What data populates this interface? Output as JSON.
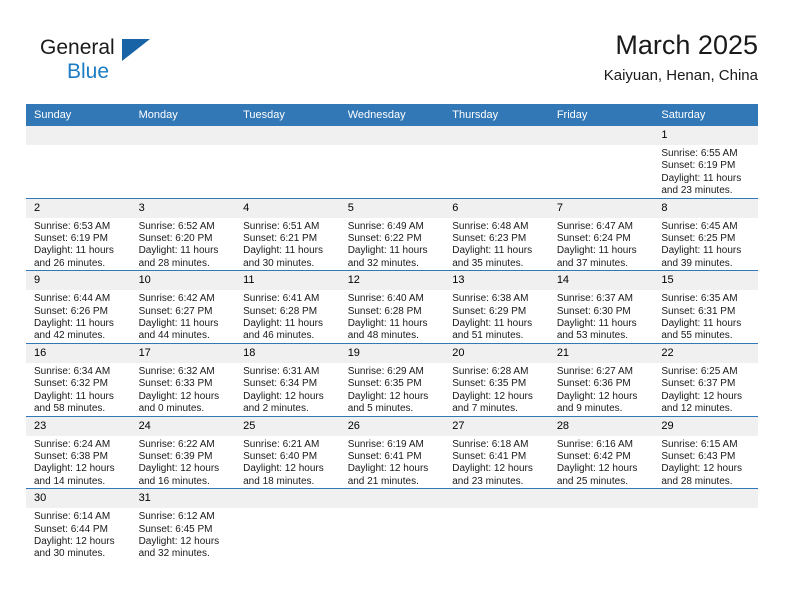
{
  "logo": {
    "word_top": "General",
    "word_bottom": "Blue",
    "flag_color": "#1763a5",
    "blue_text_color": "#1c7cc4"
  },
  "header": {
    "title": "March 2025",
    "subtitle": "Kaiyuan, Henan, China"
  },
  "theme": {
    "header_bg": "#3277b6",
    "header_text": "#ffffff",
    "daynum_bg": "#f0f0f0",
    "row_border": "#3277b6"
  },
  "calendar": {
    "weekday_headers": [
      "Sunday",
      "Monday",
      "Tuesday",
      "Wednesday",
      "Thursday",
      "Friday",
      "Saturday"
    ],
    "labels": {
      "sunrise": "Sunrise:",
      "sunset": "Sunset:",
      "daylight": "Daylight:"
    },
    "weeks": [
      [
        {
          "day": "",
          "empty": true
        },
        {
          "day": "",
          "empty": true
        },
        {
          "day": "",
          "empty": true
        },
        {
          "day": "",
          "empty": true
        },
        {
          "day": "",
          "empty": true
        },
        {
          "day": "",
          "empty": true
        },
        {
          "day": "1",
          "sunrise": "Sunrise: 6:55 AM",
          "sunset": "Sunset: 6:19 PM",
          "daylight": "Daylight: 11 hours and 23 minutes."
        }
      ],
      [
        {
          "day": "2",
          "sunrise": "Sunrise: 6:53 AM",
          "sunset": "Sunset: 6:19 PM",
          "daylight": "Daylight: 11 hours and 26 minutes."
        },
        {
          "day": "3",
          "sunrise": "Sunrise: 6:52 AM",
          "sunset": "Sunset: 6:20 PM",
          "daylight": "Daylight: 11 hours and 28 minutes."
        },
        {
          "day": "4",
          "sunrise": "Sunrise: 6:51 AM",
          "sunset": "Sunset: 6:21 PM",
          "daylight": "Daylight: 11 hours and 30 minutes."
        },
        {
          "day": "5",
          "sunrise": "Sunrise: 6:49 AM",
          "sunset": "Sunset: 6:22 PM",
          "daylight": "Daylight: 11 hours and 32 minutes."
        },
        {
          "day": "6",
          "sunrise": "Sunrise: 6:48 AM",
          "sunset": "Sunset: 6:23 PM",
          "daylight": "Daylight: 11 hours and 35 minutes."
        },
        {
          "day": "7",
          "sunrise": "Sunrise: 6:47 AM",
          "sunset": "Sunset: 6:24 PM",
          "daylight": "Daylight: 11 hours and 37 minutes."
        },
        {
          "day": "8",
          "sunrise": "Sunrise: 6:45 AM",
          "sunset": "Sunset: 6:25 PM",
          "daylight": "Daylight: 11 hours and 39 minutes."
        }
      ],
      [
        {
          "day": "9",
          "sunrise": "Sunrise: 6:44 AM",
          "sunset": "Sunset: 6:26 PM",
          "daylight": "Daylight: 11 hours and 42 minutes."
        },
        {
          "day": "10",
          "sunrise": "Sunrise: 6:42 AM",
          "sunset": "Sunset: 6:27 PM",
          "daylight": "Daylight: 11 hours and 44 minutes."
        },
        {
          "day": "11",
          "sunrise": "Sunrise: 6:41 AM",
          "sunset": "Sunset: 6:28 PM",
          "daylight": "Daylight: 11 hours and 46 minutes."
        },
        {
          "day": "12",
          "sunrise": "Sunrise: 6:40 AM",
          "sunset": "Sunset: 6:28 PM",
          "daylight": "Daylight: 11 hours and 48 minutes."
        },
        {
          "day": "13",
          "sunrise": "Sunrise: 6:38 AM",
          "sunset": "Sunset: 6:29 PM",
          "daylight": "Daylight: 11 hours and 51 minutes."
        },
        {
          "day": "14",
          "sunrise": "Sunrise: 6:37 AM",
          "sunset": "Sunset: 6:30 PM",
          "daylight": "Daylight: 11 hours and 53 minutes."
        },
        {
          "day": "15",
          "sunrise": "Sunrise: 6:35 AM",
          "sunset": "Sunset: 6:31 PM",
          "daylight": "Daylight: 11 hours and 55 minutes."
        }
      ],
      [
        {
          "day": "16",
          "sunrise": "Sunrise: 6:34 AM",
          "sunset": "Sunset: 6:32 PM",
          "daylight": "Daylight: 11 hours and 58 minutes."
        },
        {
          "day": "17",
          "sunrise": "Sunrise: 6:32 AM",
          "sunset": "Sunset: 6:33 PM",
          "daylight": "Daylight: 12 hours and 0 minutes."
        },
        {
          "day": "18",
          "sunrise": "Sunrise: 6:31 AM",
          "sunset": "Sunset: 6:34 PM",
          "daylight": "Daylight: 12 hours and 2 minutes."
        },
        {
          "day": "19",
          "sunrise": "Sunrise: 6:29 AM",
          "sunset": "Sunset: 6:35 PM",
          "daylight": "Daylight: 12 hours and 5 minutes."
        },
        {
          "day": "20",
          "sunrise": "Sunrise: 6:28 AM",
          "sunset": "Sunset: 6:35 PM",
          "daylight": "Daylight: 12 hours and 7 minutes."
        },
        {
          "day": "21",
          "sunrise": "Sunrise: 6:27 AM",
          "sunset": "Sunset: 6:36 PM",
          "daylight": "Daylight: 12 hours and 9 minutes."
        },
        {
          "day": "22",
          "sunrise": "Sunrise: 6:25 AM",
          "sunset": "Sunset: 6:37 PM",
          "daylight": "Daylight: 12 hours and 12 minutes."
        }
      ],
      [
        {
          "day": "23",
          "sunrise": "Sunrise: 6:24 AM",
          "sunset": "Sunset: 6:38 PM",
          "daylight": "Daylight: 12 hours and 14 minutes."
        },
        {
          "day": "24",
          "sunrise": "Sunrise: 6:22 AM",
          "sunset": "Sunset: 6:39 PM",
          "daylight": "Daylight: 12 hours and 16 minutes."
        },
        {
          "day": "25",
          "sunrise": "Sunrise: 6:21 AM",
          "sunset": "Sunset: 6:40 PM",
          "daylight": "Daylight: 12 hours and 18 minutes."
        },
        {
          "day": "26",
          "sunrise": "Sunrise: 6:19 AM",
          "sunset": "Sunset: 6:41 PM",
          "daylight": "Daylight: 12 hours and 21 minutes."
        },
        {
          "day": "27",
          "sunrise": "Sunrise: 6:18 AM",
          "sunset": "Sunset: 6:41 PM",
          "daylight": "Daylight: 12 hours and 23 minutes."
        },
        {
          "day": "28",
          "sunrise": "Sunrise: 6:16 AM",
          "sunset": "Sunset: 6:42 PM",
          "daylight": "Daylight: 12 hours and 25 minutes."
        },
        {
          "day": "29",
          "sunrise": "Sunrise: 6:15 AM",
          "sunset": "Sunset: 6:43 PM",
          "daylight": "Daylight: 12 hours and 28 minutes."
        }
      ],
      [
        {
          "day": "30",
          "sunrise": "Sunrise: 6:14 AM",
          "sunset": "Sunset: 6:44 PM",
          "daylight": "Daylight: 12 hours and 30 minutes."
        },
        {
          "day": "31",
          "sunrise": "Sunrise: 6:12 AM",
          "sunset": "Sunset: 6:45 PM",
          "daylight": "Daylight: 12 hours and 32 minutes."
        },
        {
          "day": "",
          "empty": true
        },
        {
          "day": "",
          "empty": true
        },
        {
          "day": "",
          "empty": true
        },
        {
          "day": "",
          "empty": true
        },
        {
          "day": "",
          "empty": true
        }
      ]
    ]
  }
}
